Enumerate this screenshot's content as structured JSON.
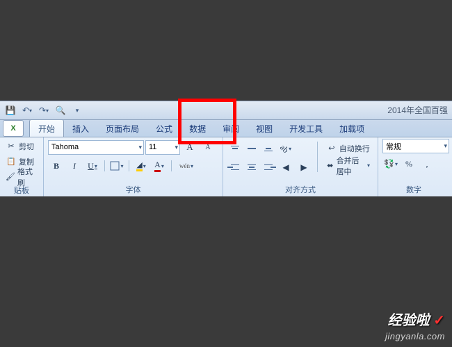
{
  "qat": {
    "save": "💾",
    "undo": "↶",
    "redo": "↷",
    "print": "🔍"
  },
  "docTitle": "2014年全国百强",
  "officeBtn": "X",
  "tabs": {
    "home": "开始",
    "insert": "插入",
    "layout": "页面布局",
    "formula": "公式",
    "data": "数据",
    "review": "审阅",
    "view": "视图",
    "developer": "开发工具",
    "addins": "加载项"
  },
  "clipboard": {
    "cut": "剪切",
    "copy": "复制",
    "paste": "格式刷",
    "groupLabel": "贴板"
  },
  "font": {
    "name": "Tahoma",
    "size": "11",
    "increase": "A",
    "decrease": "A",
    "bold": "B",
    "italic": "I",
    "underline": "U",
    "phonetic": "wén",
    "groupLabel": "字体"
  },
  "align": {
    "wrap": "自动换行",
    "merge": "合并后居中",
    "groupLabel": "对齐方式"
  },
  "number": {
    "format": "常规",
    "currency": "%",
    "groupLabel": "数字"
  },
  "watermark": {
    "logo": "经验啦",
    "url": "jingyanla.com"
  }
}
